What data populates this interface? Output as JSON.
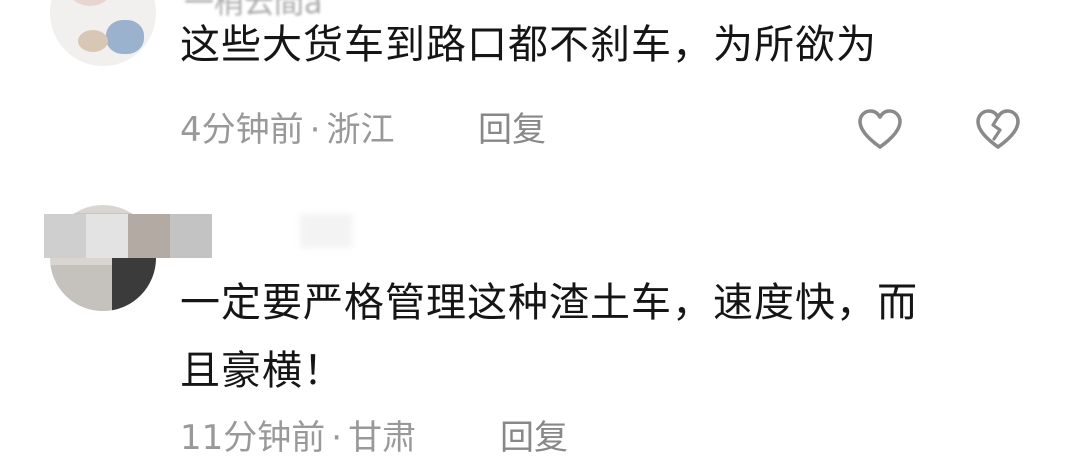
{
  "comments": [
    {
      "username": "一梢云間ä",
      "content": "这些大货车到路口都不刹车，为所欲为",
      "time": "4分钟前",
      "location": "浙江",
      "reply_label": "回复",
      "like_icon": "heart-icon",
      "dislike_icon": "broken-heart-icon"
    },
    {
      "content": "一定要严格管理这种渣土车，速度快，而",
      "content_line2": "且豪横！",
      "time": "11分钟前",
      "location": "甘肃",
      "reply_label": "回复"
    }
  ],
  "colors": {
    "text": "#151515",
    "meta": "#999999",
    "icon": "#8a8a8a",
    "background": "#ffffff"
  }
}
